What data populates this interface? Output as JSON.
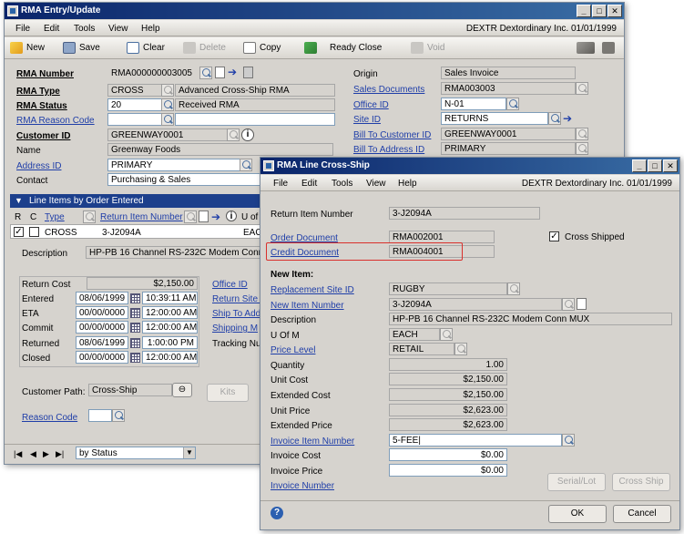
{
  "main_window": {
    "title": "RMA Entry/Update",
    "menu": [
      "File",
      "Edit",
      "Tools",
      "View",
      "Help"
    ],
    "company": "DEXTR  Dextordinary Inc.  01/01/1999",
    "toolbar": {
      "new": "New",
      "save": "Save",
      "clear": "Clear",
      "delete": "Delete",
      "copy": "Copy",
      "ready_close": "Ready Close",
      "void": "Void"
    },
    "fields": {
      "rma_number_label": "RMA Number",
      "rma_number": "RMA000000003005",
      "rma_type_label": "RMA Type",
      "rma_type": "CROSS",
      "rma_type_desc": "Advanced Cross-Ship RMA",
      "rma_status_label": "RMA Status",
      "rma_status": "20",
      "rma_status_desc": "Received RMA",
      "rma_reason_label": "RMA Reason Code",
      "customer_id_label": "Customer ID",
      "customer_id": "GREENWAY0001",
      "name_label": "Name",
      "name": "Greenway Foods",
      "address_id_label": "Address ID",
      "address_id": "PRIMARY",
      "contact_label": "Contact",
      "contact": "Purchasing & Sales",
      "origin_label": "Origin",
      "origin": "Sales Invoice",
      "sales_docs_label": "Sales Documents",
      "sales_docs": "RMA003003",
      "office_id_label": "Office ID",
      "office_id": "N-01",
      "site_id_label": "Site ID",
      "site_id": "RETURNS",
      "bill_to_customer_label": "Bill To Customer ID",
      "bill_to_customer": "GREENWAY0001",
      "bill_to_address_label": "Bill To Address ID",
      "bill_to_address": "PRIMARY"
    },
    "line_items": {
      "header": "Line Items by Order Entered",
      "col_r": "R",
      "col_c": "C",
      "col_type": "Type",
      "col_return_item": "Return Item Number",
      "col_uof": "U of",
      "row_type": "CROSS",
      "row_item": "3-J2094A",
      "row_uof": "EAC",
      "description_label": "Description",
      "description": "HP-PB 16 Channel RS-232C Modem Conn M",
      "return_cost_label": "Return Cost",
      "return_cost": "$2,150.00",
      "entered_label": "Entered",
      "entered_date": "08/06/1999",
      "entered_time": "10:39:11  AM",
      "eta_label": "ETA",
      "eta_date": "00/00/0000",
      "eta_time": "12:00:00  AM",
      "commit_label": "Commit",
      "commit_date": "00/00/0000",
      "commit_time": "12:00:00  AM",
      "returned_label": "Returned",
      "returned_date": "08/06/1999",
      "returned_time": "1:00:00  PM",
      "closed_label": "Closed",
      "closed_date": "00/00/0000",
      "closed_time": "12:00:00  AM",
      "office_id_link": "Office ID",
      "return_site_link": "Return Site I",
      "ship_to_link": "Ship To Add",
      "shipping_method_link": "Shipping M",
      "tracking_label": "Tracking Nu",
      "customer_path_label": "Customer Path:",
      "customer_path": "Cross-Ship",
      "kits_button": "Kits",
      "reason_code_label": "Reason Code"
    },
    "footer": {
      "sort": "by Status"
    }
  },
  "dialog": {
    "title": "RMA Line Cross-Ship",
    "menu": [
      "File",
      "Edit",
      "Tools",
      "View",
      "Help"
    ],
    "company": "DEXTR  Dextordinary Inc.  01/01/1999",
    "return_item_label": "Return Item Number",
    "return_item": "3-J2094A",
    "order_doc_label": "Order Document",
    "order_doc": "RMA002001",
    "cross_shipped_label": "Cross Shipped",
    "credit_doc_label": "Credit Document",
    "credit_doc": "RMA004001",
    "new_item_header": "New Item:",
    "replacement_site_label": "Replacement Site ID",
    "replacement_site": "RUGBY",
    "new_item_number_label": "New Item Number",
    "new_item_number": "3-J2094A",
    "description_label": "Description",
    "description": "HP-PB 16 Channel RS-232C Modem Conn MUX",
    "uofm_label": "U Of M",
    "uofm": "EACH",
    "price_level_label": "Price Level",
    "price_level": "RETAIL",
    "quantity_label": "Quantity",
    "quantity": "1.00",
    "unit_cost_label": "Unit Cost",
    "unit_cost": "$2,150.00",
    "extended_cost_label": "Extended Cost",
    "extended_cost": "$2,150.00",
    "unit_price_label": "Unit Price",
    "unit_price": "$2,623.00",
    "extended_price_label": "Extended Price",
    "extended_price": "$2,623.00",
    "invoice_item_label": "Invoice Item Number",
    "invoice_item": "5-FEE|",
    "invoice_cost_label": "Invoice Cost",
    "invoice_cost": "$0.00",
    "invoice_price_label": "Invoice Price",
    "invoice_price": "$0.00",
    "invoice_number_label": "Invoice Number",
    "serial_lot_button": "Serial/Lot",
    "cross_ship_button": "Cross Ship",
    "ok_button": "OK",
    "cancel_button": "Cancel"
  }
}
